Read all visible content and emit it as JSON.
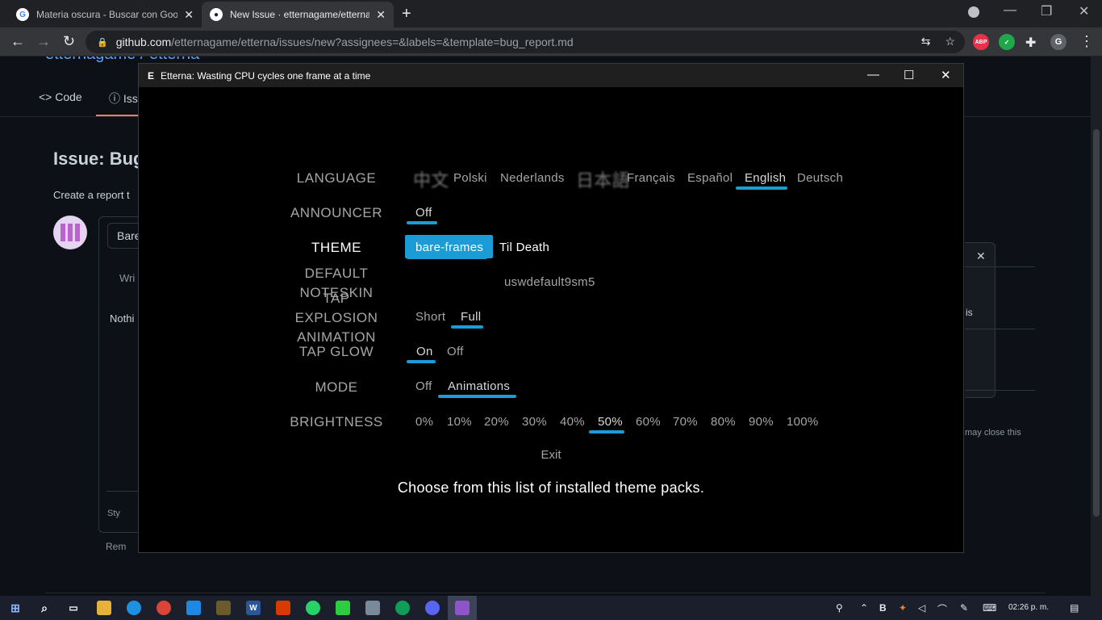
{
  "browser": {
    "tabs": [
      {
        "title": "Materia oscura - Buscar con Goo",
        "icon": "google-icon",
        "icon_glyph": "G",
        "active": false
      },
      {
        "title": "New Issue · etternagame/etterna",
        "icon": "github-icon",
        "icon_glyph": "●",
        "active": true
      }
    ],
    "new_tab_glyph": "+",
    "window_controls": [
      "—",
      "❐",
      "✕"
    ],
    "nav_glyphs": {
      "back": "←",
      "forward": "→",
      "reload": "↻",
      "lock": "🔒",
      "translate": "⇆",
      "star": "☆",
      "puzzle": "✚",
      "menu": "⋮"
    },
    "url_host": "github.com",
    "url_path": "/etternagame/etterna/issues/new?assignees=&labels=&template=bug_report.md",
    "extensions": [
      {
        "name": "adblock-plus-icon",
        "label": "ABP",
        "color": "#e8314a"
      },
      {
        "name": "checkmark-extension-icon",
        "label": "✓",
        "color": "#1fa84b"
      },
      {
        "name": "profile-avatar",
        "label": "G",
        "color": "#5f6368"
      }
    ]
  },
  "github": {
    "repo": "etternagame / etterna",
    "nav": {
      "code": "Code",
      "issues": "Iss"
    },
    "issue_title": "Issue: Bug",
    "create_text": "Create a report t",
    "title_input": "Bare",
    "write_tab": "Wri",
    "body_text": "Nothi",
    "styling": "Sty",
    "remember": "Rem",
    "right_text": "is",
    "may_close": "may close this",
    "close_glyph": "✕"
  },
  "etterna": {
    "window_title": "Etterna: Wasting CPU cycles one frame at a time",
    "window_icon": "E",
    "window_controls": [
      "—",
      "☐",
      "✕"
    ],
    "options": [
      {
        "label": "LANGUAGE",
        "choices": [
          "中文",
          "Polski",
          "Nederlands",
          "日本語",
          "Français",
          "Español",
          "English",
          "Deutsch"
        ],
        "selected": "English"
      },
      {
        "label": "ANNOUNCER",
        "choices": [
          "Off"
        ],
        "selected": "Off"
      },
      {
        "label": "THEME",
        "choices": [
          "bare-frames",
          "Til Death"
        ],
        "selected": "bare-frames"
      },
      {
        "label": "DEFAULT NOTESKIN",
        "choices": [
          "uswdefault9sm5"
        ],
        "selected": ""
      },
      {
        "label": "TAP EXPLOSION ANIMATION",
        "choices": [
          "Short",
          "Full"
        ],
        "selected": "Full"
      },
      {
        "label": "TAP GLOW",
        "choices": [
          "On",
          "Off"
        ],
        "selected": "On"
      },
      {
        "label": "MODE",
        "choices": [
          "Off",
          "Animations"
        ],
        "selected": "Animations"
      },
      {
        "label": "BRIGHTNESS",
        "choices": [
          "0%",
          "10%",
          "20%",
          "30%",
          "40%",
          "50%",
          "60%",
          "70%",
          "80%",
          "90%",
          "100%"
        ],
        "selected": "50%"
      }
    ],
    "label_lines": {
      "default_noteskin": [
        "DEFAULT",
        "NOTESKIN"
      ],
      "tap_explosion": [
        "TAP",
        "EXPLOSION",
        "ANIMATION"
      ]
    },
    "exit": "Exit",
    "hint": "Choose from this list of installed theme packs.",
    "accent_color": "#1a9cd6"
  },
  "taskbar": {
    "clock": "02:26 p. m."
  }
}
